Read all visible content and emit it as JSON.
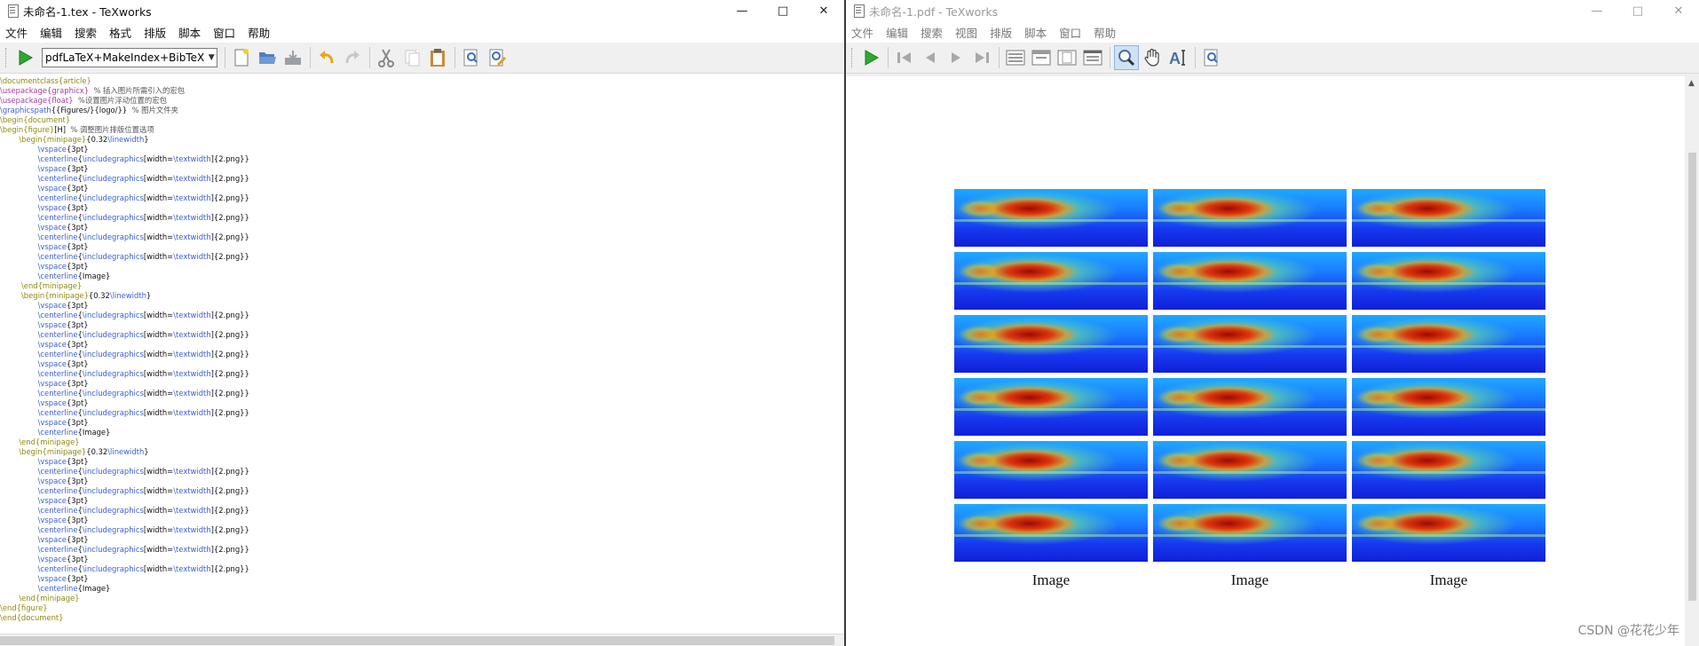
{
  "left_window": {
    "title": "未命名-1.tex - TeXworks",
    "menu": [
      "文件",
      "编辑",
      "搜索",
      "格式",
      "排版",
      "脚本",
      "窗口",
      "帮助"
    ],
    "typeset_engine": "pdfLaTeX+MakeIndex+BibTeX",
    "icons": {
      "typeset": "play-icon",
      "new": "new-document-icon",
      "open": "open-folder-icon",
      "save": "save-icon",
      "undo": "undo-icon",
      "redo": "redo-icon",
      "cut": "cut-icon",
      "copy": "copy-icon",
      "paste": "paste-icon",
      "find": "find-icon",
      "replace": "find-replace-icon"
    },
    "code_lines": [
      "\\documentclass{article}",
      "\\usepackage{graphicx}  % 插入图片所需引入的宏包",
      "\\usepackage{float}  %设置图片浮动位置的宏包",
      "\\graphicspath{{Figures/}{logo/}}  % 图片文件夹",
      "\\begin{document}",
      "\\begin{figure}[H]  % 调整图片排版位置选项",
      "        \\begin{minipage}{0.32\\linewidth}",
      "                \\vspace{3pt}",
      "                \\centerline{\\includegraphics[width=\\textwidth]{2.png}}",
      "                \\vspace{3pt}",
      "                \\centerline{\\includegraphics[width=\\textwidth]{2.png}}",
      "                \\vspace{3pt}",
      "                \\centerline{\\includegraphics[width=\\textwidth]{2.png}}",
      "                \\vspace{3pt}",
      "                \\centerline{\\includegraphics[width=\\textwidth]{2.png}}",
      "                \\vspace{3pt}",
      "                \\centerline{\\includegraphics[width=\\textwidth]{2.png}}",
      "                \\vspace{3pt}",
      "                \\centerline{\\includegraphics[width=\\textwidth]{2.png}}",
      "                \\vspace{3pt}",
      "                \\centerline{Image}",
      "         \\end{minipage}",
      "         \\begin{minipage}{0.32\\linewidth}",
      "                \\vspace{3pt}",
      "                \\centerline{\\includegraphics[width=\\textwidth]{2.png}}",
      "                \\vspace{3pt}",
      "                \\centerline{\\includegraphics[width=\\textwidth]{2.png}}",
      "                \\vspace{3pt}",
      "                \\centerline{\\includegraphics[width=\\textwidth]{2.png}}",
      "                \\vspace{3pt}",
      "                \\centerline{\\includegraphics[width=\\textwidth]{2.png}}",
      "                \\vspace{3pt}",
      "                \\centerline{\\includegraphics[width=\\textwidth]{2.png}}",
      "                \\vspace{3pt}",
      "                \\centerline{\\includegraphics[width=\\textwidth]{2.png}}",
      "                \\vspace{3pt}",
      "                \\centerline{Image}",
      "        \\end{minipage}",
      "        \\begin{minipage}{0.32\\linewidth}",
      "                \\vspace{3pt}",
      "                \\centerline{\\includegraphics[width=\\textwidth]{2.png}}",
      "                \\vspace{3pt}",
      "                \\centerline{\\includegraphics[width=\\textwidth]{2.png}}",
      "                \\vspace{3pt}",
      "                \\centerline{\\includegraphics[width=\\textwidth]{2.png}}",
      "                \\vspace{3pt}",
      "                \\centerline{\\includegraphics[width=\\textwidth]{2.png}}",
      "                \\vspace{3pt}",
      "                \\centerline{\\includegraphics[width=\\textwidth]{2.png}}",
      "                \\vspace{3pt}",
      "                \\centerline{\\includegraphics[width=\\textwidth]{2.png}}",
      "                \\vspace{3pt}",
      "                \\centerline{Image}",
      "        \\end{minipage}",
      "\\end{figure}",
      "\\end{document}"
    ]
  },
  "right_window": {
    "title": "未命名-1.pdf - TeXworks",
    "menu": [
      "文件",
      "编辑",
      "搜索",
      "视图",
      "排版",
      "脚本",
      "窗口",
      "帮助"
    ],
    "icons": {
      "typeset": "play-icon",
      "first_page": "first-page-icon",
      "prev_page": "previous-page-icon",
      "next_page": "next-page-icon",
      "last_page": "last-page-icon",
      "actual_size": "actual-size-icon",
      "fit_width": "fit-width-icon",
      "fit_page": "fit-page-icon",
      "full_screen": "fit-window-icon",
      "magnify": "magnifier-icon",
      "scroll": "hand-icon",
      "select_text": "select-text-icon",
      "find": "find-icon"
    },
    "figure": {
      "columns": 3,
      "rows": 6,
      "captions": [
        "Image",
        "Image",
        "Image"
      ]
    }
  },
  "watermark": "CSDN @花花少年"
}
